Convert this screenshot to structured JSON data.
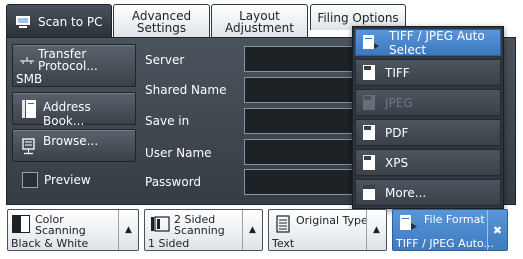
{
  "tabs": [
    {
      "label": "Scan to PC",
      "active": true
    },
    {
      "label_line1": "Advanced",
      "label_line2": "Settings"
    },
    {
      "label_line1": "Layout",
      "label_line2": "Adjustment"
    },
    {
      "label": "Filing Options"
    }
  ],
  "left_buttons": {
    "transfer_line1": "Transfer",
    "transfer_line2": "Protocol...",
    "transfer_value": "SMB",
    "address_book": "Address Book...",
    "browse": "Browse...",
    "preview": "Preview"
  },
  "fields": {
    "server": "Server",
    "shared_name": "Shared Name",
    "save_in": "Save in",
    "user_name": "User Name",
    "password": "Password"
  },
  "dropdown": {
    "items": [
      {
        "label": "TIFF / JPEG Auto Select",
        "state": "selected"
      },
      {
        "label": "TIFF",
        "state": "normal"
      },
      {
        "label": "JPEG",
        "state": "disabled"
      },
      {
        "label": "PDF",
        "state": "normal"
      },
      {
        "label": "XPS",
        "state": "normal"
      },
      {
        "label": "More...",
        "state": "normal"
      }
    ]
  },
  "features": {
    "color_line1": "Color",
    "color_line2": "Scanning",
    "color_value": "Black & White",
    "sided_line1": "2 Sided",
    "sided_line2": "Scanning",
    "sided_value": "1 Sided",
    "original_title": "Original Type",
    "original_value": "Text",
    "format_title": "File Format",
    "format_value": "TIFF / JPEG Auto...",
    "close_glyph": "✖",
    "arrow_glyph": "▲"
  },
  "colors": {
    "accent_blue": "#4a88cf",
    "panel_dark": "#3a4149"
  }
}
